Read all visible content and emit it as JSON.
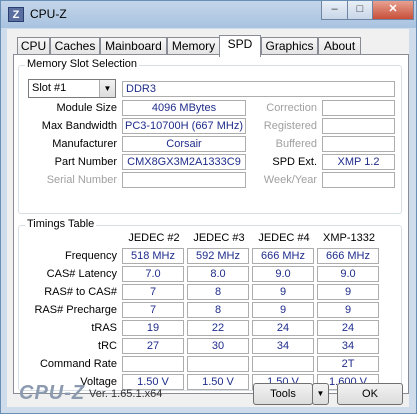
{
  "window": {
    "title": "CPU-Z",
    "icon_letter": "Z",
    "minimize": "–",
    "maximize": "□",
    "close": "✕"
  },
  "tabs": [
    "CPU",
    "Caches",
    "Mainboard",
    "Memory",
    "SPD",
    "Graphics",
    "About"
  ],
  "active_tab": "SPD",
  "memory_slot": {
    "group_title": "Memory Slot Selection",
    "slot": "Slot #1",
    "type": "DDR3",
    "module_size_label": "Module Size",
    "module_size": "4096 MBytes",
    "max_bandwidth_label": "Max Bandwidth",
    "max_bandwidth": "PC3-10700H (667 MHz)",
    "manufacturer_label": "Manufacturer",
    "manufacturer": "Corsair",
    "part_number_label": "Part Number",
    "part_number": "CMX8GX3M2A1333C9",
    "serial_number_label": "Serial Number",
    "serial_number": "",
    "correction_label": "Correction",
    "correction": "",
    "registered_label": "Registered",
    "registered": "",
    "buffered_label": "Buffered",
    "buffered": "",
    "spd_ext_label": "SPD Ext.",
    "spd_ext": "XMP 1.2",
    "week_year_label": "Week/Year",
    "week_year": ""
  },
  "timings": {
    "group_title": "Timings Table",
    "columns": [
      "JEDEC #2",
      "JEDEC #3",
      "JEDEC #4",
      "XMP-1332"
    ],
    "rows": [
      {
        "label": "Frequency",
        "values": [
          "518 MHz",
          "592 MHz",
          "666 MHz",
          "666 MHz"
        ]
      },
      {
        "label": "CAS# Latency",
        "values": [
          "7.0",
          "8.0",
          "9.0",
          "9.0"
        ]
      },
      {
        "label": "RAS# to CAS#",
        "values": [
          "7",
          "8",
          "9",
          "9"
        ]
      },
      {
        "label": "RAS# Precharge",
        "values": [
          "7",
          "8",
          "9",
          "9"
        ]
      },
      {
        "label": "tRAS",
        "values": [
          "19",
          "22",
          "24",
          "24"
        ]
      },
      {
        "label": "tRC",
        "values": [
          "27",
          "30",
          "34",
          "34"
        ]
      },
      {
        "label": "Command Rate",
        "values": [
          "",
          "",
          "",
          "2T"
        ]
      },
      {
        "label": "Voltage",
        "values": [
          "1.50 V",
          "1.50 V",
          "1.50 V",
          "1.600 V"
        ]
      }
    ]
  },
  "footer": {
    "logo": "CPU-Z",
    "version": "Ver. 1.65.1.x64",
    "tools_label": "Tools",
    "ok_label": "OK"
  }
}
